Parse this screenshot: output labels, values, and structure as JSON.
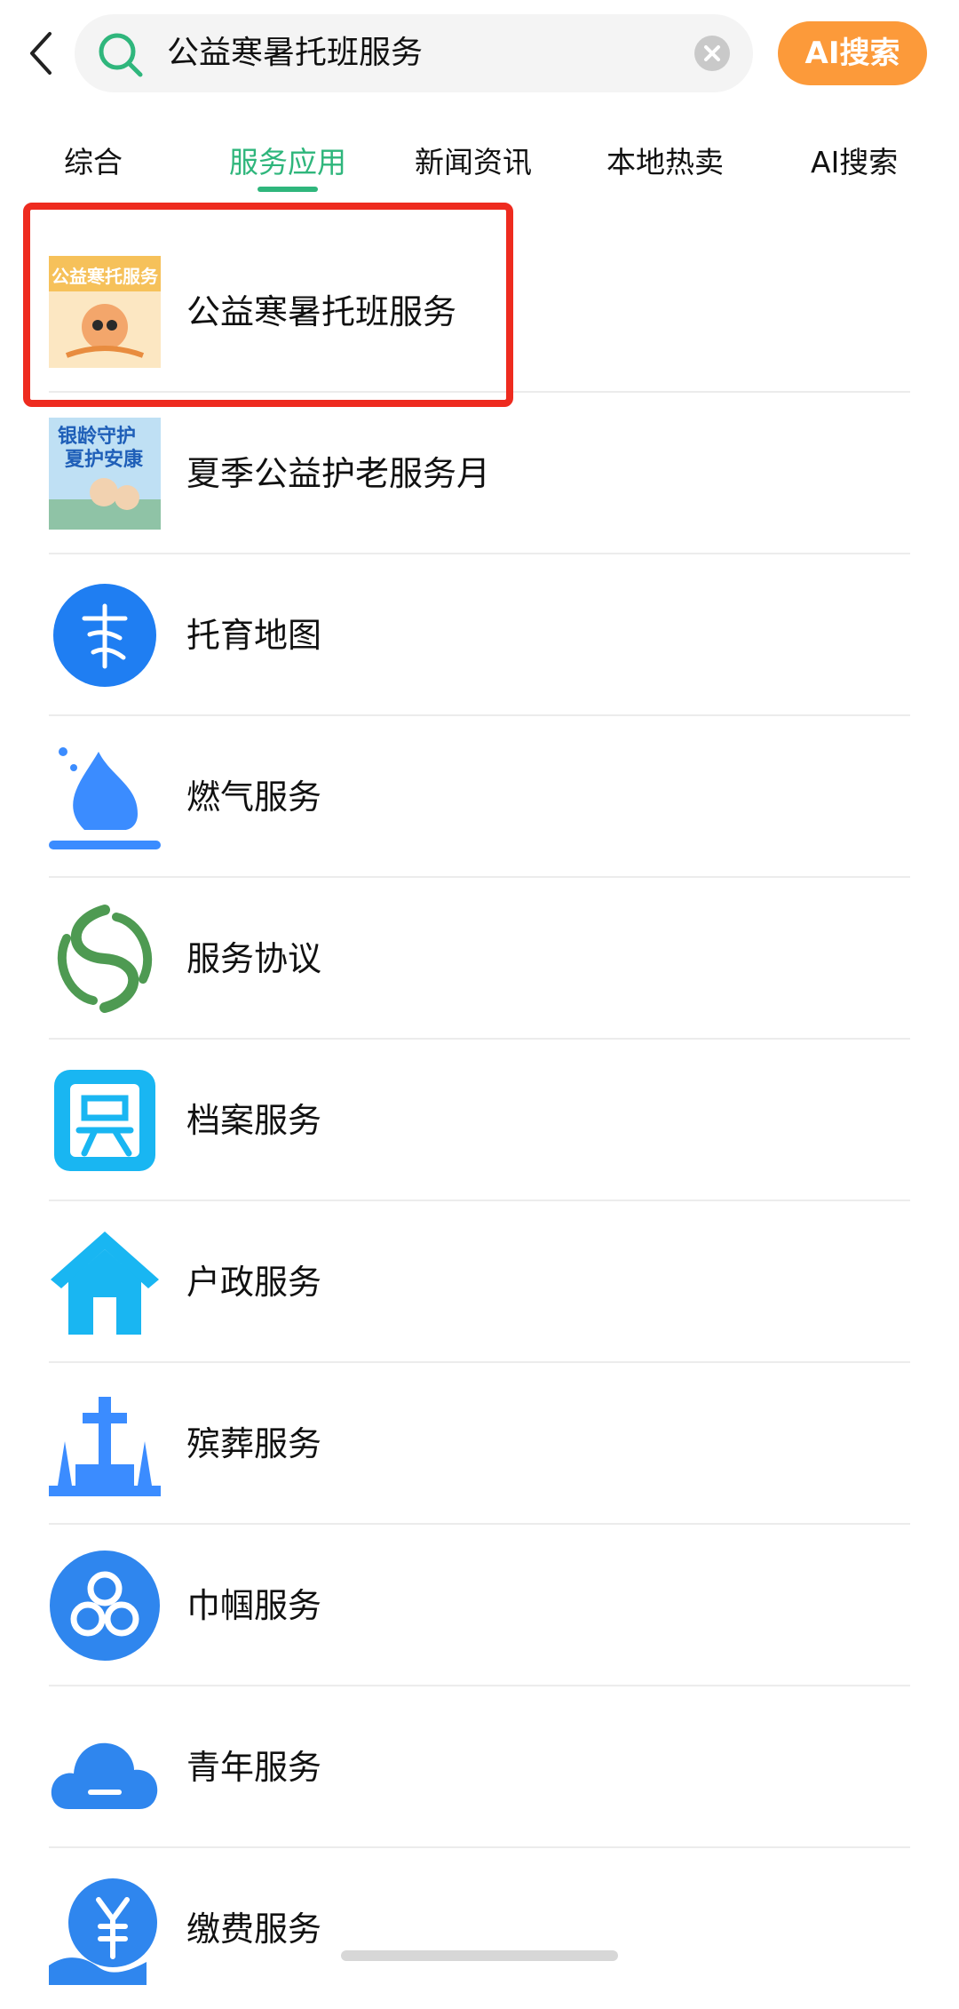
{
  "header": {
    "search_value": "公益寒暑托班服务",
    "ai_button_label": "AI搜索"
  },
  "tabs": [
    {
      "label": "综合"
    },
    {
      "label": "服务应用"
    },
    {
      "label": "新闻资讯"
    },
    {
      "label": "本地热卖"
    },
    {
      "label": "AI搜索"
    }
  ],
  "active_tab": "服务应用",
  "results": [
    {
      "label": "公益寒暑托班服务",
      "icon": "winter-summer-class-thumbnail-icon",
      "highlighted": true
    },
    {
      "label": "夏季公益护老服务月",
      "icon": "elderly-care-thumbnail-icon"
    },
    {
      "label": "托育地图",
      "icon": "childcare-map-icon"
    },
    {
      "label": "燃气服务",
      "icon": "gas-flame-icon"
    },
    {
      "label": "服务协议",
      "icon": "agreement-swirl-icon"
    },
    {
      "label": "档案服务",
      "icon": "archive-seal-icon"
    },
    {
      "label": "户政服务",
      "icon": "house-icon"
    },
    {
      "label": "殡葬服务",
      "icon": "memorial-icon"
    },
    {
      "label": "巾帼服务",
      "icon": "women-federation-icon"
    },
    {
      "label": "青年服务",
      "icon": "youth-cloud-icon"
    },
    {
      "label": "缴费服务",
      "icon": "payment-yuan-icon"
    }
  ],
  "thumbnail_text": {
    "winter_summer": "公益寒托服务",
    "elderly_line1": "银龄守护",
    "elderly_line2": "夏护安康"
  },
  "colors": {
    "accent_green": "#2fb67c",
    "ai_button_orange": "#fc9a3a",
    "highlight_red": "#ee2b1f",
    "icon_blue": "#2f86ee",
    "icon_green": "#4e9a52",
    "icon_cyan": "#19b6f2"
  }
}
